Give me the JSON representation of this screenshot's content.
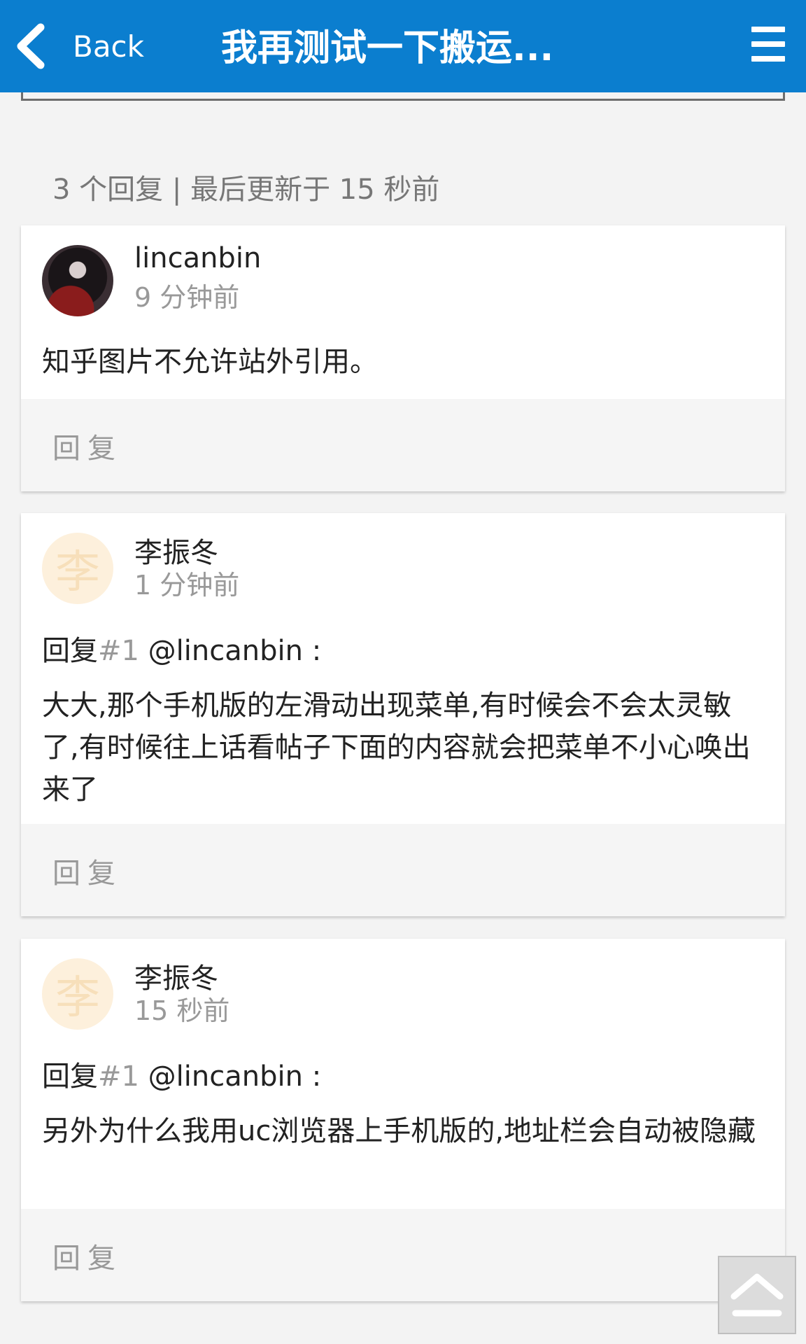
{
  "header": {
    "back_label": "Back",
    "title": "我再测试一下搬运...",
    "color": "#0b7ecf"
  },
  "topic_meta": "3 个回复 | 最后更新于 15 秒前",
  "posts": [
    {
      "author": "lincanbin",
      "time": "9 分钟前",
      "avatar": "photo",
      "content": "知乎图片不允许站外引用。",
      "reply_label": "回复"
    },
    {
      "author": "李振冬",
      "time": "1 分钟前",
      "avatar": "letter",
      "avatar_letter": "李",
      "reply_prefix": "回复",
      "reply_num": "#1",
      "reply_to": " @lincanbin :",
      "content": "大大,那个手机版的左滑动出现菜单,有时候会不会太灵敏了,有时候往上话看帖子下面的内容就会把菜单不小心唤出来了",
      "reply_label": "回复"
    },
    {
      "author": "李振冬",
      "time": "15 秒前",
      "avatar": "letter",
      "avatar_letter": "李",
      "reply_prefix": "回复",
      "reply_num": "#1",
      "reply_to": " @lincanbin :",
      "content": "另外为什么我用uc浏览器上手机版的,地址栏会自动被隐藏",
      "reply_label": "回复"
    }
  ],
  "icons": {
    "back": "chevron-left-icon",
    "menu": "hamburger-menu-icon",
    "scroll_top": "chevron-up-icon"
  }
}
